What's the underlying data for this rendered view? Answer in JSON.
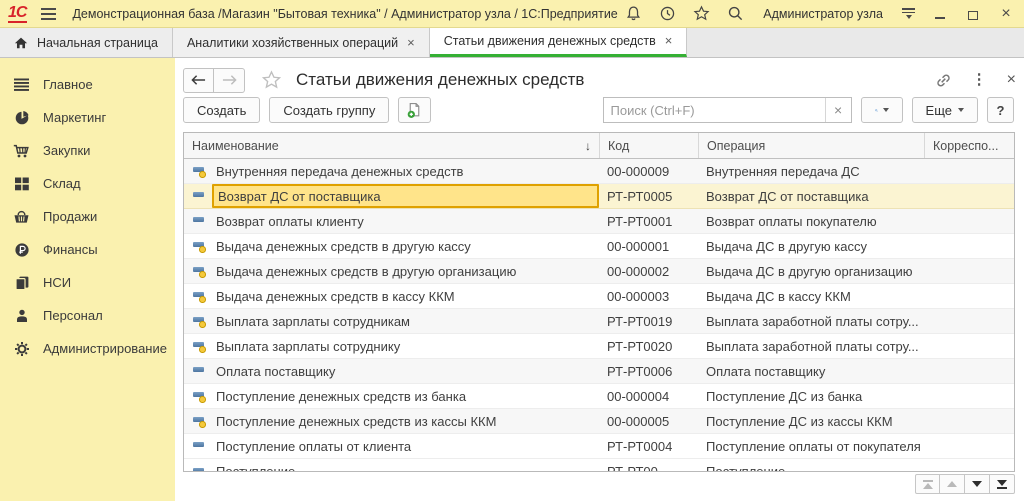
{
  "titlebar": {
    "logo": "1С",
    "title": "Демонстрационная база /Магазин \"Бытовая техника\" / Администратор узла / 1С:Предприятие",
    "user": "Администратор узла"
  },
  "tabs": {
    "home_label": "Начальная страница",
    "tab1_label": "Аналитики хозяйственных операций",
    "tab2_label": "Статьи движения денежных средств",
    "close_glyph": "×"
  },
  "sidebar": {
    "items": [
      {
        "icon": "menu-icon",
        "label": "Главное"
      },
      {
        "icon": "pie-chart-icon",
        "label": "Маркетинг"
      },
      {
        "icon": "cart-icon",
        "label": "Закупки"
      },
      {
        "icon": "warehouse-grid-icon",
        "label": "Склад"
      },
      {
        "icon": "basket-icon",
        "label": "Продажи"
      },
      {
        "icon": "ruble-icon",
        "label": "Финансы"
      },
      {
        "icon": "books-icon",
        "label": "НСИ"
      },
      {
        "icon": "person-icon",
        "label": "Персонал"
      },
      {
        "icon": "gear-icon",
        "label": "Администрирование"
      }
    ]
  },
  "panel": {
    "title": "Статьи движения денежных средств",
    "toolbar": {
      "create_label": "Создать",
      "create_group_label": "Создать группу",
      "search_placeholder": "Поиск (Ctrl+F)",
      "clear_glyph": "×",
      "more_label": "Еще",
      "help_label": "?"
    },
    "sort_glyph": "↓"
  },
  "table": {
    "columns": {
      "name": "Наименование",
      "code": "Код",
      "operation": "Операция",
      "correspondent": "Корреспо..."
    },
    "rows": [
      {
        "name": "Внутренняя передача денежных средств",
        "code": "00-000009",
        "operation": "Внутренняя передача ДС",
        "predefined": true,
        "selected": false
      },
      {
        "name": "Возврат ДС от поставщика",
        "code": "РТ-РТ0005",
        "operation": "Возврат ДС от поставщика",
        "predefined": false,
        "selected": true
      },
      {
        "name": "Возврат оплаты клиенту",
        "code": "РТ-РТ0001",
        "operation": "Возврат оплаты покупателю",
        "predefined": false,
        "selected": false
      },
      {
        "name": "Выдача денежных средств в другую кассу",
        "code": "00-000001",
        "operation": "Выдача ДС в другую кассу",
        "predefined": true,
        "selected": false
      },
      {
        "name": "Выдача денежных средств в другую организацию",
        "code": "00-000002",
        "operation": "Выдача ДС в другую организацию",
        "predefined": true,
        "selected": false
      },
      {
        "name": "Выдача денежных средств в кассу ККМ",
        "code": "00-000003",
        "operation": "Выдача ДС в кассу ККМ",
        "predefined": true,
        "selected": false
      },
      {
        "name": "Выплата зарплаты сотрудникам",
        "code": "РТ-РТ0019",
        "operation": "Выплата заработной платы сотру...",
        "predefined": true,
        "selected": false
      },
      {
        "name": "Выплата зарплаты сотруднику",
        "code": "РТ-РТ0020",
        "operation": "Выплата заработной платы сотру...",
        "predefined": true,
        "selected": false
      },
      {
        "name": "Оплата поставщику",
        "code": "РТ-РТ0006",
        "operation": "Оплата поставщику",
        "predefined": false,
        "selected": false
      },
      {
        "name": "Поступление денежных средств из банка",
        "code": "00-000004",
        "operation": "Поступление ДС из банка",
        "predefined": true,
        "selected": false
      },
      {
        "name": "Поступление денежных средств из кассы ККМ",
        "code": "00-000005",
        "operation": "Поступление ДС из кассы ККМ",
        "predefined": true,
        "selected": false
      },
      {
        "name": "Поступление оплаты от клиента",
        "code": "РТ-РТ0004",
        "operation": "Поступление оплаты от покупателя",
        "predefined": false,
        "selected": false
      }
    ],
    "partial_row": {
      "name": "Поступление",
      "code": "РТ-РТ00",
      "operation": "Поступление",
      "predefined": true
    }
  },
  "colors": {
    "topbar_yellow": "#FAF1AF",
    "accent_green": "#35B034",
    "selection_row": "#FBF4D2",
    "selection_cell": "#FFE48A",
    "selection_border": "#DFA100",
    "logo_red": "#D8232A"
  }
}
